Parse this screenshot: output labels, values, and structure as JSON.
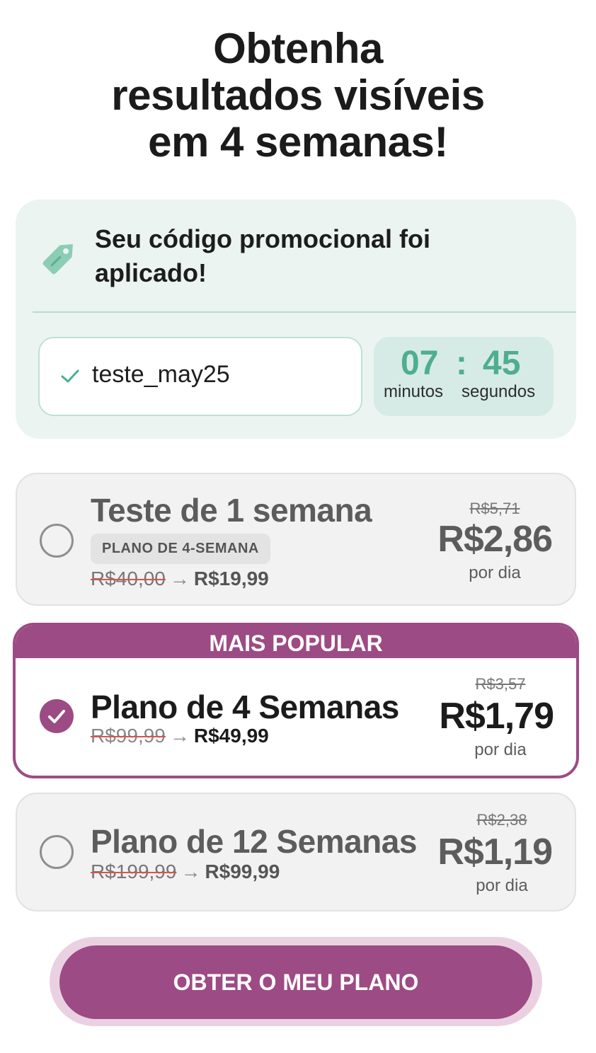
{
  "headline": {
    "line1": "Obtenha",
    "line2": "resultados visíveis",
    "line3": "em 4 semanas!"
  },
  "promo": {
    "icon": "tag-icon",
    "message": "Seu código promocional foi aplicado!",
    "code": "teste_may25",
    "code_icon": "check-icon",
    "timer": {
      "minutes": "07",
      "separator": ":",
      "seconds": "45",
      "minutes_label": "minutos",
      "seconds_label": "segundos"
    }
  },
  "plans": [
    {
      "name": "Teste de 1 semana",
      "badge": "PLANO DE 4-SEMANA",
      "old_price": "R$40,00",
      "arrow": "→",
      "new_price": "R$19,99",
      "old_per_day": "R$5,71",
      "per_day": "R$2,86",
      "per_day_unit": "por dia",
      "selected": false
    },
    {
      "tag": "MAIS POPULAR",
      "name": "Plano de 4 Semanas",
      "old_price": "R$99,99",
      "arrow": "→",
      "new_price": "R$49,99",
      "old_per_day": "R$3,57",
      "per_day": "R$1,79",
      "per_day_unit": "por dia",
      "selected": true
    },
    {
      "name": "Plano de 12 Semanas",
      "old_price": "R$199,99",
      "arrow": "→",
      "new_price": "R$99,99",
      "old_per_day": "R$2,38",
      "per_day": "R$1,19",
      "per_day_unit": "por dia",
      "selected": false
    }
  ],
  "cta": {
    "label": "OBTER O MEU PLANO"
  },
  "colors": {
    "accent": "#9d4b84",
    "promo_bg": "#ebf4f1",
    "timer_text": "#4eae8e",
    "check": "#4eae8e"
  }
}
